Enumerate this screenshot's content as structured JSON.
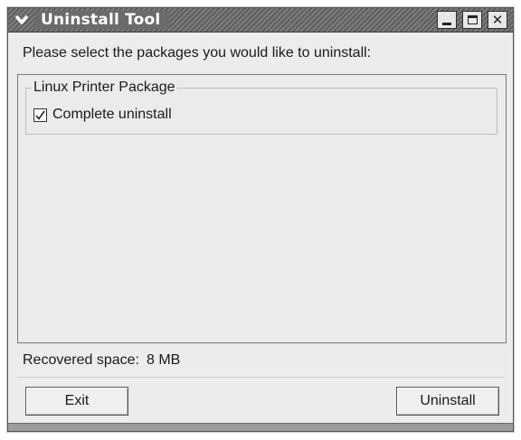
{
  "window": {
    "title": "Uninstall Tool"
  },
  "prompt": "Please select the packages you would like to uninstall:",
  "package_group": {
    "legend": "Linux Printer Package",
    "option_label": "Complete uninstall",
    "checked": true
  },
  "status": {
    "label": "Recovered space:",
    "value": "8 MB"
  },
  "buttons": {
    "exit_label": "Exit",
    "uninstall_label": "Uninstall"
  },
  "icons": {
    "window_menu": "chevron-down-icon",
    "minimize": "minimize-icon",
    "maximize": "maximize-icon",
    "close": "close-icon",
    "check": "checkmark-icon"
  },
  "colors": {
    "window_bg": "#ececec",
    "titlebar": "#6b6b6b",
    "title_text": "#ffffff"
  }
}
